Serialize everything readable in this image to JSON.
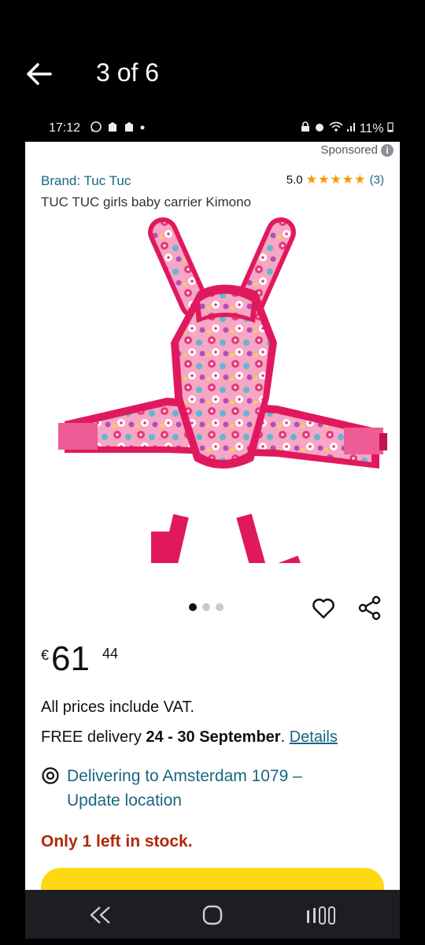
{
  "viewer": {
    "counter": "3 of 6"
  },
  "status_bar": {
    "time": "17:12",
    "battery": "11%",
    "left_icons": [
      "whatsapp-icon",
      "mosque-icon",
      "mosque-icon",
      "dot-icon"
    ],
    "right_icons": [
      "lock-icon",
      "alarm-icon",
      "wifi-icon",
      "signal-icon",
      "battery-icon"
    ]
  },
  "product": {
    "sponsored": "Sponsored",
    "brand": "Brand: Tuc Tuc",
    "rating": "5.0",
    "stars": "★★★★★",
    "rating_count": "(3)",
    "title": "TUC TUC girls baby carrier Kimono",
    "image_index": 1,
    "image_count": 3
  },
  "price": {
    "symbol": "€",
    "whole": "61",
    "fraction": "44"
  },
  "info": {
    "vat": "All prices include VAT.",
    "delivery_prefix": "FREE delivery ",
    "delivery_dates": "24 - 30 September",
    "delivery_suffix": ". ",
    "details_link": "Details",
    "location_line1": "Delivering to Amsterdam 1079 –",
    "location_line2": "Update location",
    "stock": "Only 1 left in stock."
  },
  "colors": {
    "link": "#1a6582",
    "stock": "#b12704",
    "star": "#f59a00",
    "button": "#ffd814",
    "carrier_pink": "#e0195f"
  }
}
